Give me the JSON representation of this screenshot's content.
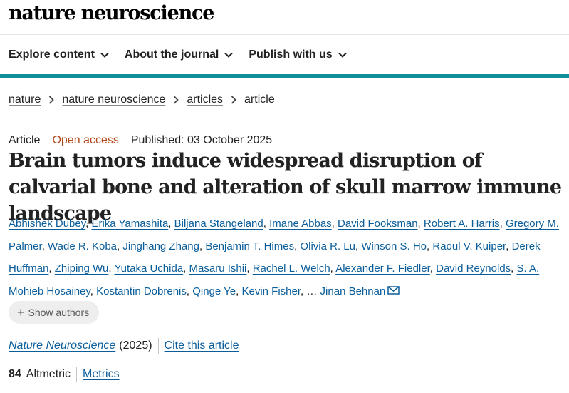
{
  "site": {
    "logo": "nature neuroscience"
  },
  "nav": {
    "items": [
      {
        "label": "Explore content"
      },
      {
        "label": "About the journal"
      },
      {
        "label": "Publish with us"
      }
    ]
  },
  "breadcrumb": {
    "items": [
      "nature",
      "nature neuroscience",
      "articles"
    ],
    "current": "article"
  },
  "article": {
    "type": "Article",
    "access": "Open access",
    "published": "Published: 03 October 2025",
    "title": "Brain tumors induce widespread disruption of calvarial bone and alteration of skull marrow immune landscape",
    "authors": [
      "Abhishek Dubey",
      "Erika Yamashita",
      "Biljana Stangeland",
      "Imane Abbas",
      "David Fooksman",
      "Robert A. Harris",
      "Gregory M. Palmer",
      "Wade R. Koba",
      "Jinghang Zhang",
      "Benjamin T. Himes",
      "Olivia R. Lu",
      "Winson S. Ho",
      "Raoul V. Kuiper",
      "Derek Huffman",
      "Zhiping Wu",
      "Yutaka Uchida",
      "Masaru Ishii",
      "Rachel L. Welch",
      "Alexander F. Fiedler",
      "David Reynolds",
      "S. A. Mohieb Hosainey",
      "Kostantin Dobrenis",
      "Qinge Ye",
      "Kevin Fisher"
    ],
    "ellipsis": "…",
    "corresponding_author": "Jinan Behnan",
    "show_authors_label": "Show authors",
    "journal": "Nature Neuroscience",
    "year": "(2025)",
    "cite_label": "Cite this article",
    "altmetric_score": "84",
    "altmetric_label": "Altmetric",
    "metrics_label": "Metrics"
  },
  "colors": {
    "teal_bar": "#0f8f99",
    "link": "#0a5d9b",
    "open_access": "#b0481a"
  }
}
